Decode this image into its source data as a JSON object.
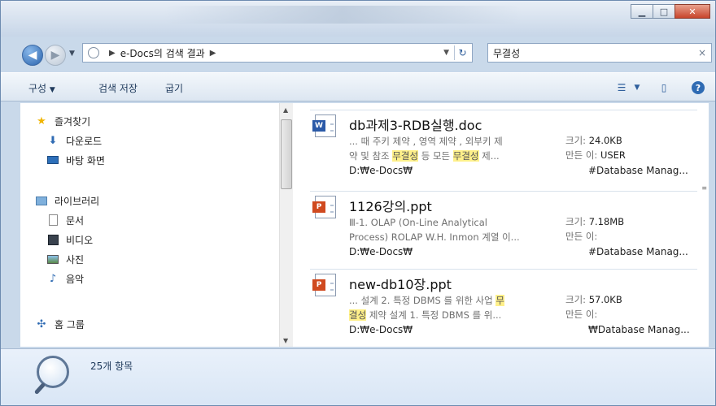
{
  "address_bar": {
    "crumb": "e-Docs의 검색 결과"
  },
  "search": {
    "query": "무결성"
  },
  "toolbar": {
    "organize_label": "구성",
    "save_search_label": "검색 저장",
    "burn_label": "굽기"
  },
  "nav": {
    "favorites_label": "즐겨찾기",
    "favorites_items": [
      {
        "label": "다운로드",
        "icon": "download-folder-icon"
      },
      {
        "label": "바탕 화면",
        "icon": "desktop-icon"
      }
    ],
    "libraries_label": "라이브러리",
    "library_items": [
      {
        "label": "문서",
        "icon": "documents-icon"
      },
      {
        "label": "비디오",
        "icon": "videos-icon"
      },
      {
        "label": "사진",
        "icon": "pictures-icon"
      },
      {
        "label": "음악",
        "icon": "music-icon"
      }
    ],
    "homegroup_label": "홈 그룹"
  },
  "results": [
    {
      "title": "db과제3-RDB실행.doc",
      "type": "word",
      "snippet_line1": [
        "... 때 주키 제약 , 영역 제약 , 외부키 제",
        ""
      ],
      "snippet_line2": [
        "약 및 참조 ",
        "무결성",
        " 등 모든 ",
        "무결성",
        " 제..."
      ],
      "size_label": "크기:",
      "size": "24.0KB",
      "author_label": "만든 이:",
      "author": "USER",
      "path": "D:₩e-Docs₩",
      "folder": "#Database Manag..."
    },
    {
      "title": "1126강의.ppt",
      "type": "ppt",
      "snippet_line1": [
        "Ⅲ-1. OLAP (On-Line Analytical"
      ],
      "snippet_line2": [
        "Process) ROLAP W.H. Inmon 계열 이..."
      ],
      "size_label": "크기:",
      "size": "7.18MB",
      "author_label": "만든 이:",
      "author": "",
      "path": "D:₩e-Docs₩",
      "folder": "#Database Manag..."
    },
    {
      "title": "new-db10장.ppt",
      "type": "ppt",
      "snippet_line1": [
        "... 설계 2. 특정 DBMS 를 위한 사업 ",
        "무"
      ],
      "snippet_line2": [
        "결성",
        " 제약 설계 1. 특정 DBMS 를 위..."
      ],
      "size_label": "크기:",
      "size": "57.0KB",
      "author_label": "만든 이:",
      "author": "",
      "path": "D:₩e-Docs₩",
      "folder": "₩Database Manag..."
    }
  ],
  "details": {
    "item_count": "25개 항목"
  },
  "colors": {
    "highlight": "#fff08a",
    "accent": "#2b64ad"
  }
}
